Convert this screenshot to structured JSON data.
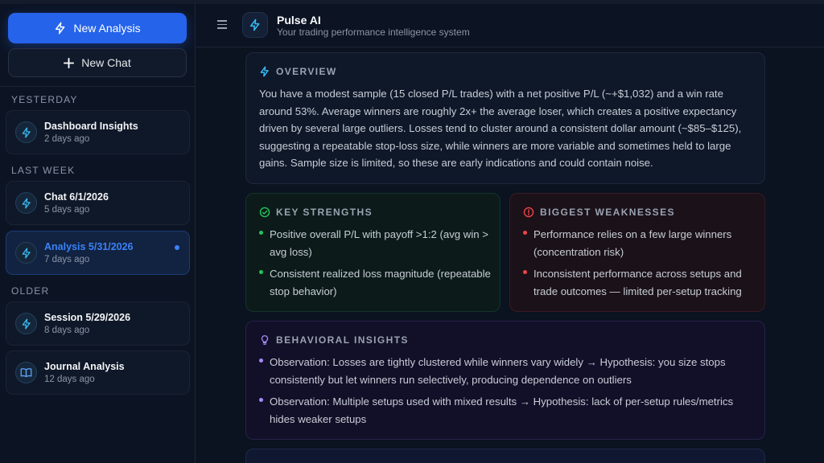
{
  "sidebar": {
    "new_analysis": "New Analysis",
    "new_chat": "New Chat",
    "sections": [
      {
        "label": "YESTERDAY",
        "items": [
          {
            "title": "Dashboard Insights",
            "sub": "2 days ago",
            "icon": "bolt-icon"
          }
        ]
      },
      {
        "label": "LAST WEEK",
        "items": [
          {
            "title": "Chat 6/1/2026",
            "sub": "5 days ago",
            "icon": "bolt-icon"
          },
          {
            "title": "Analysis 5/31/2026",
            "sub": "7 days ago",
            "icon": "bolt-icon",
            "active": true
          }
        ]
      },
      {
        "label": "OLDER",
        "items": [
          {
            "title": "Session 5/29/2026",
            "sub": "8 days ago",
            "icon": "bolt-icon"
          },
          {
            "title": "Journal Analysis",
            "sub": "12 days ago",
            "icon": "book-icon"
          }
        ]
      }
    ]
  },
  "header": {
    "title": "Pulse AI",
    "subtitle": "Your trading performance intelligence system"
  },
  "main": {
    "overview": {
      "label": "OVERVIEW",
      "text": "You have a modest sample (15 closed P/L trades) with a net positive P/L (~+$1,032) and a win rate around 53%. Average winners are roughly 2x+ the average loser, which creates a positive expectancy driven by several large outliers. Losses tend to cluster around a consistent dollar amount (~$85–$125), suggesting a repeatable stop-loss size, while winners are more variable and sometimes held to large gains. Sample size is limited, so these are early indications and could contain noise."
    },
    "strengths": {
      "label": "KEY STRENGTHS",
      "items": [
        "Positive overall P/L with payoff >1:2 (avg win > avg loss)",
        "Consistent realized loss magnitude (repeatable stop behavior)"
      ]
    },
    "weaknesses": {
      "label": "BIGGEST WEAKNESSES",
      "items": [
        "Performance relies on a few large winners (concentration risk)",
        "Inconsistent performance across setups and trade outcomes — limited per-setup tracking"
      ]
    },
    "behavior": {
      "label": "BEHAVIORAL INSIGHTS",
      "items": [
        "Observation: Losses are tightly clustered while winners vary widely → Hypothesis: you size stops consistently but let winners run selectively, producing dependence on outliers",
        "Observation: Multiple setups used with mixed results → Hypothesis: lack of per-setup rules/metrics hides weaker setups"
      ]
    }
  },
  "colors": {
    "accent": "#2563eb",
    "bolt": "#38bdf8",
    "strength": "#22c55e",
    "weakness": "#ef4444",
    "behavior": "#a78bfa"
  }
}
